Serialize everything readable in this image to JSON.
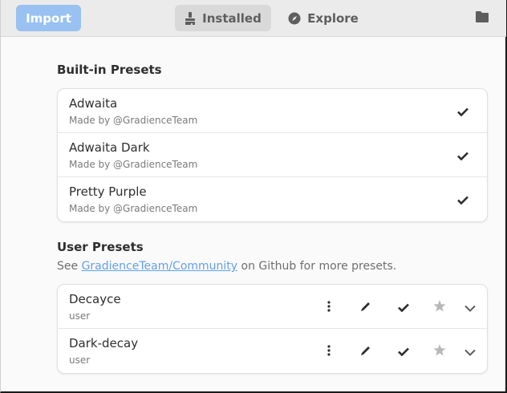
{
  "header": {
    "import_label": "Import",
    "tabs": [
      {
        "label": "Installed",
        "icon": "brush-icon",
        "active": true
      },
      {
        "label": "Explore",
        "icon": "compass-icon",
        "active": false
      }
    ],
    "folder_icon": "folder-icon"
  },
  "builtin": {
    "title": "Built-in Presets",
    "presets": [
      {
        "name": "Adwaita",
        "author": "Made by @GradienceTeam"
      },
      {
        "name": "Adwaita Dark",
        "author": "Made by @GradienceTeam"
      },
      {
        "name": "Pretty Purple",
        "author": "Made by @GradienceTeam"
      }
    ]
  },
  "user": {
    "title": "User Presets",
    "note_prefix": "See ",
    "note_link": "GradienceTeam/Community",
    "note_suffix": " on Github for more presets.",
    "presets": [
      {
        "name": "Decayce",
        "author": "user"
      },
      {
        "name": "Dark-decay",
        "author": "user"
      }
    ]
  },
  "colors": {
    "accent": "#99c1f1",
    "link": "#62a0ea",
    "headerbar": "#ebebeb"
  }
}
